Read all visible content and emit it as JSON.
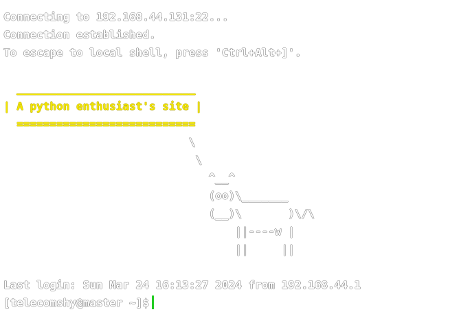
{
  "terminal": {
    "connect_lines": [
      "Connecting to 192.168.44.131:22...",
      "Connection established.",
      "To escape to local shell, press 'Ctrl+Alt+]'."
    ],
    "banner": {
      "top_border": "  ___________________________",
      "title": "| A python enthusiast's site |",
      "bottom_border": "  ===========================",
      "art": [
        "                            \\",
        "                             \\",
        "                               ^__^",
        "                               (oo)\\_______",
        "                               (__)\\       )\\/\\",
        "                                   ||----w |",
        "                                   ||     ||"
      ]
    },
    "last_login": "Last login: Sun Mar 24 16:13:27 2024 from 192.168.44.1",
    "prompt": "[telecomshy@master ~]$"
  },
  "colors": {
    "banner": "#f2e600",
    "cursor": "#22cc22",
    "background": "#ffffff"
  }
}
